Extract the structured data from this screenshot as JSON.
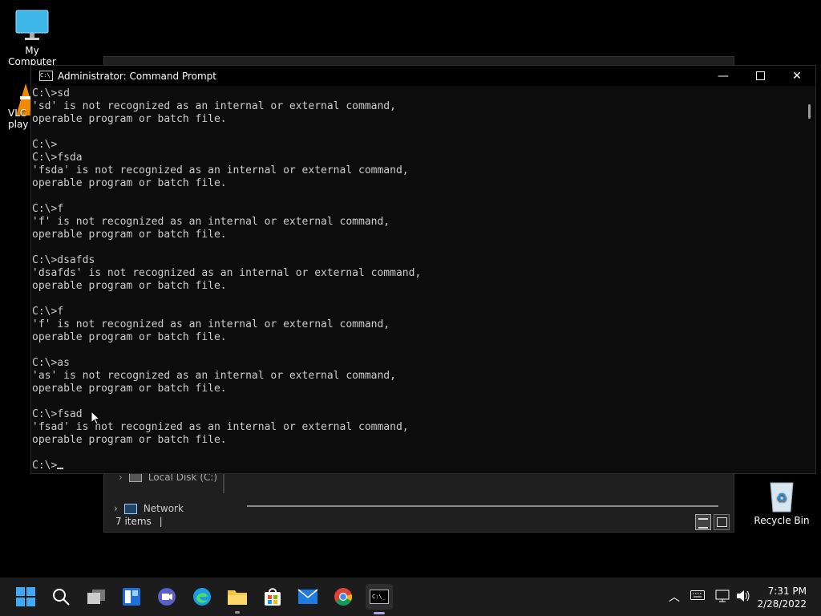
{
  "desktop": {
    "icons": [
      {
        "label": "My Computer",
        "icon": "monitor-icon"
      },
      {
        "label": "VLC r\nplay",
        "icon": "vlc-icon"
      },
      {
        "label": "Recycle Bin",
        "icon": "recycle-bin-icon"
      }
    ]
  },
  "explorer": {
    "nav_local_disk": "Local Disk (C:)",
    "nav_network": "Network",
    "status_items": "7 items"
  },
  "cmd": {
    "title": "Administrator: Command Prompt",
    "lines": [
      "C:\\>sd",
      "'sd' is not recognized as an internal or external command,",
      "operable program or batch file.",
      "",
      "C:\\>",
      "C:\\>fsda",
      "'fsda' is not recognized as an internal or external command,",
      "operable program or batch file.",
      "",
      "C:\\>f",
      "'f' is not recognized as an internal or external command,",
      "operable program or batch file.",
      "",
      "C:\\>dsafds",
      "'dsafds' is not recognized as an internal or external command,",
      "operable program or batch file.",
      "",
      "C:\\>f",
      "'f' is not recognized as an internal or external command,",
      "operable program or batch file.",
      "",
      "C:\\>as",
      "'as' is not recognized as an internal or external command,",
      "operable program or batch file.",
      "",
      "C:\\>fsad",
      "'fsad' is not recognized as an internal or external command,",
      "operable program or batch file.",
      ""
    ],
    "prompt": "C:\\>"
  },
  "taskbar": {
    "apps": [
      "start-icon",
      "search-icon",
      "task-view-icon",
      "widgets-icon",
      "chat-icon",
      "edge-icon",
      "file-explorer-icon",
      "store-icon",
      "mail-icon",
      "chrome-icon",
      "terminal-icon"
    ],
    "time": "7:31 PM",
    "date": "2/28/2022"
  },
  "colors": {
    "console_bg": "#0c0c0c",
    "console_fg": "#cccccc",
    "taskbar_bg": "#1c1c1c",
    "accent": "#0078d4"
  }
}
